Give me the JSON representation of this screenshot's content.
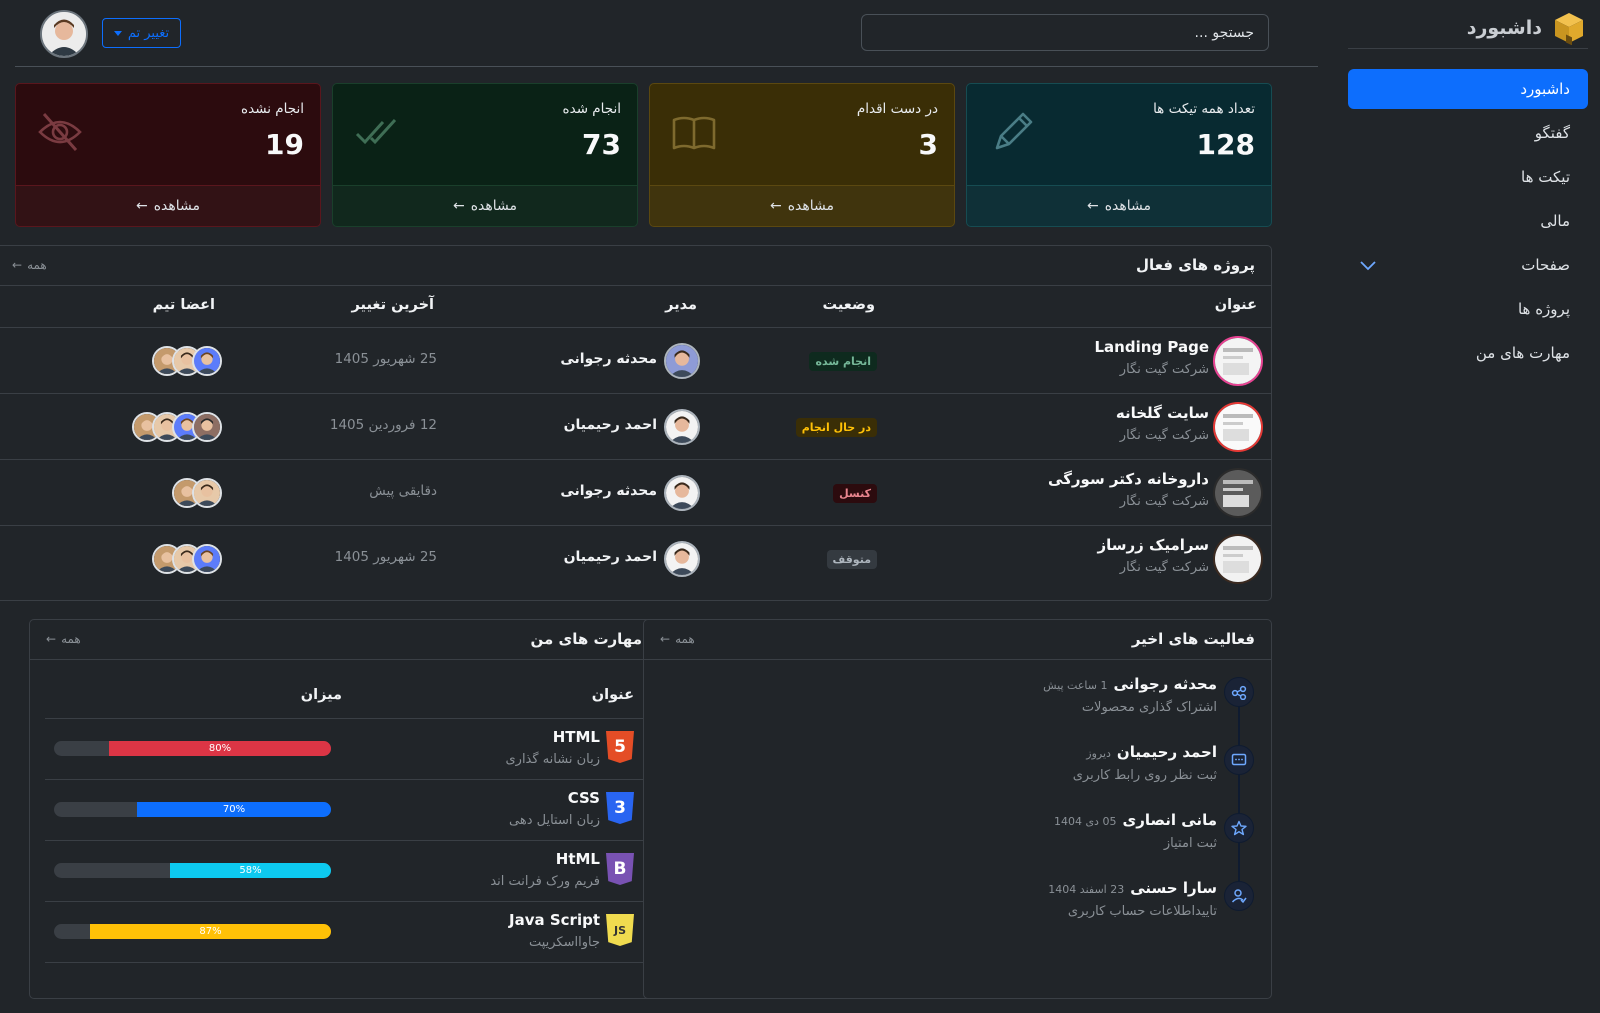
{
  "brand": {
    "title": "داشبورد"
  },
  "sidebar": {
    "items": [
      {
        "label": "داشبورد"
      },
      {
        "label": "گفتگو"
      },
      {
        "label": "تیکت ها"
      },
      {
        "label": "مالی"
      },
      {
        "label": "صفحات"
      },
      {
        "label": "پروژه ها"
      },
      {
        "label": "مهارت های من"
      }
    ]
  },
  "header": {
    "search_placeholder": "جستجو ...",
    "theme_label": "تغییر تم"
  },
  "stats": [
    {
      "title": "تعداد همه تیکت ها",
      "value": "128",
      "link": "مشاهده",
      "icon": "pencil-icon",
      "bg": "#082a31",
      "border": "#164c52"
    },
    {
      "title": "در دست اقدام",
      "value": "3",
      "link": "مشاهده",
      "icon": "book-icon",
      "bg": "#3a2e06",
      "border": "#5b4810"
    },
    {
      "title": "انجام شده",
      "value": "73",
      "link": "مشاهده",
      "icon": "double-check-icon",
      "bg": "#0a2216",
      "border": "#1a3f2b"
    },
    {
      "title": "انجام نشده",
      "value": "19",
      "link": "مشاهده",
      "icon": "eye-slash-icon",
      "bg": "#2c0b0e",
      "border": "#5a161d"
    }
  ],
  "projects": {
    "title": "پروژه های فعال",
    "all_label": "همه",
    "columns": {
      "title": "عنوان",
      "status": "وضعیت",
      "manager": "مدیر",
      "updated": "آخرین تغییر",
      "team": "اعضا تیم"
    },
    "rows": [
      {
        "name": "Landing Page",
        "company": "شرکت گیت نگار",
        "status": "انجام شده",
        "status_color": "#75b798",
        "status_bg": "#0e2a1e",
        "manager": "محدثه رجوانی",
        "updated": "25 شهریور 1405",
        "team_count": 3
      },
      {
        "name": "سایت گلخانه",
        "company": "شرکت گیت نگار",
        "status": "در حال انجام",
        "status_color": "#ffc107",
        "status_bg": "#3a2e06",
        "manager": "احمد رحیمیان",
        "updated": "12 فروردین 1405",
        "team_count": 4
      },
      {
        "name": "داروخانه دکتر سورگی",
        "company": "شرکت گیت نگار",
        "status": "کنسل",
        "status_color": "#ea868f",
        "status_bg": "#2c0b0e",
        "manager": "محدثه رجوانی",
        "updated": "دقایقی پیش",
        "team_count": 2
      },
      {
        "name": "سرامیک زرساز",
        "company": "شرکت گیت نگار",
        "status": "متوقف",
        "status_color": "#adb5bd",
        "status_bg": "#343a40",
        "manager": "احمد رحیمیان",
        "updated": "25 شهریور 1405",
        "team_count": 3
      }
    ]
  },
  "activities": {
    "title": "فعالیت های اخیر",
    "all_label": "همه",
    "items": [
      {
        "name": "محدثه رجوانی",
        "time": "1 ساعت پیش",
        "desc": "اشتراک گذاری محصولات",
        "icon": "share-icon"
      },
      {
        "name": "احمد رحیمیان",
        "time": "دیروز",
        "desc": "ثبت نظر روی رابط کاربری",
        "icon": "comment-icon"
      },
      {
        "name": "مانی انصاری",
        "time": "05 دی 1404",
        "desc": "ثبت امتیاز",
        "icon": "star-icon"
      },
      {
        "name": "سارا حسنی",
        "time": "23 اسفند 1404",
        "desc": "تاییداطلاعات حساب کاربری",
        "icon": "user-check-icon"
      }
    ]
  },
  "skills": {
    "title": "مهارت های من",
    "all_label": "همه",
    "columns": {
      "title": "عنوان",
      "level": "میزان"
    },
    "items": [
      {
        "name": "HTML",
        "desc": "زبان نشانه گذاری",
        "percent": 80,
        "label": "80%",
        "color": "#dc3545",
        "icon": "html5-icon",
        "icon_color": "#e44d26",
        "glyph": "5"
      },
      {
        "name": "CSS",
        "desc": "زبان استایل دهی",
        "percent": 70,
        "label": "70%",
        "color": "#0d6efd",
        "icon": "css3-icon",
        "icon_color": "#2965f1",
        "glyph": "3"
      },
      {
        "name": "HtML",
        "desc": "فریم ورک فرانت اند",
        "percent": 58,
        "label": "58%",
        "color": "#0dcaf0",
        "icon": "bootstrap-icon",
        "icon_color": "#7952b3",
        "glyph": "B"
      },
      {
        "name": "Java Script",
        "desc": "جاوااسکریپت",
        "percent": 87,
        "label": "87%",
        "color": "#ffc107",
        "icon": "js-icon",
        "icon_color": "#f0db4f",
        "glyph": "JS"
      }
    ]
  }
}
